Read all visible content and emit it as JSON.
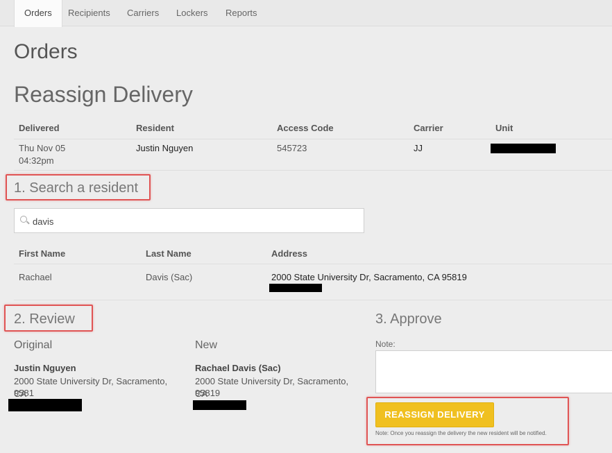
{
  "nav": {
    "tabs": [
      {
        "label": "Orders",
        "active": true
      },
      {
        "label": "Recipients"
      },
      {
        "label": "Carriers"
      },
      {
        "label": "Lockers"
      },
      {
        "label": "Reports"
      }
    ]
  },
  "page_title": "Orders",
  "section_title": "Reassign Delivery",
  "delivery_table": {
    "headers": [
      "Delivered",
      "Resident",
      "Access Code",
      "Carrier",
      "Unit"
    ],
    "row": {
      "delivered_date": "Thu Nov 05",
      "delivered_time": "04:32pm",
      "resident": "Justin Nguyen",
      "access_code": "545723",
      "carrier": "JJ",
      "unit": ""
    }
  },
  "step1": {
    "title": "1. Search a resident",
    "search_value": "davis",
    "headers": [
      "First Name",
      "Last Name",
      "Address"
    ],
    "results": [
      {
        "first_name": "Rachael",
        "last_name": "Davis (Sac)",
        "address": "2000 State University Dr, Sacramento, CA 95819"
      }
    ]
  },
  "step2": {
    "title": "2. Review",
    "original_label": "Original",
    "new_label": "New",
    "original": {
      "name": "Justin Nguyen",
      "address_line1": "2000 State University Dr, Sacramento, CA",
      "address_line2": "9581"
    },
    "new": {
      "name": "Rachael Davis (Sac)",
      "address_line1": "2000 State University Dr, Sacramento, CA",
      "address_line2": "95819"
    }
  },
  "step3": {
    "title": "3. Approve",
    "note_label": "Note:",
    "note_value": "",
    "button_label": "REASSIGN DELIVERY",
    "button_note": "Note: Once you reassign the delivery the new resident will be notified."
  },
  "colors": {
    "accent_button": "#f0c020",
    "callout_red": "#e05454"
  }
}
